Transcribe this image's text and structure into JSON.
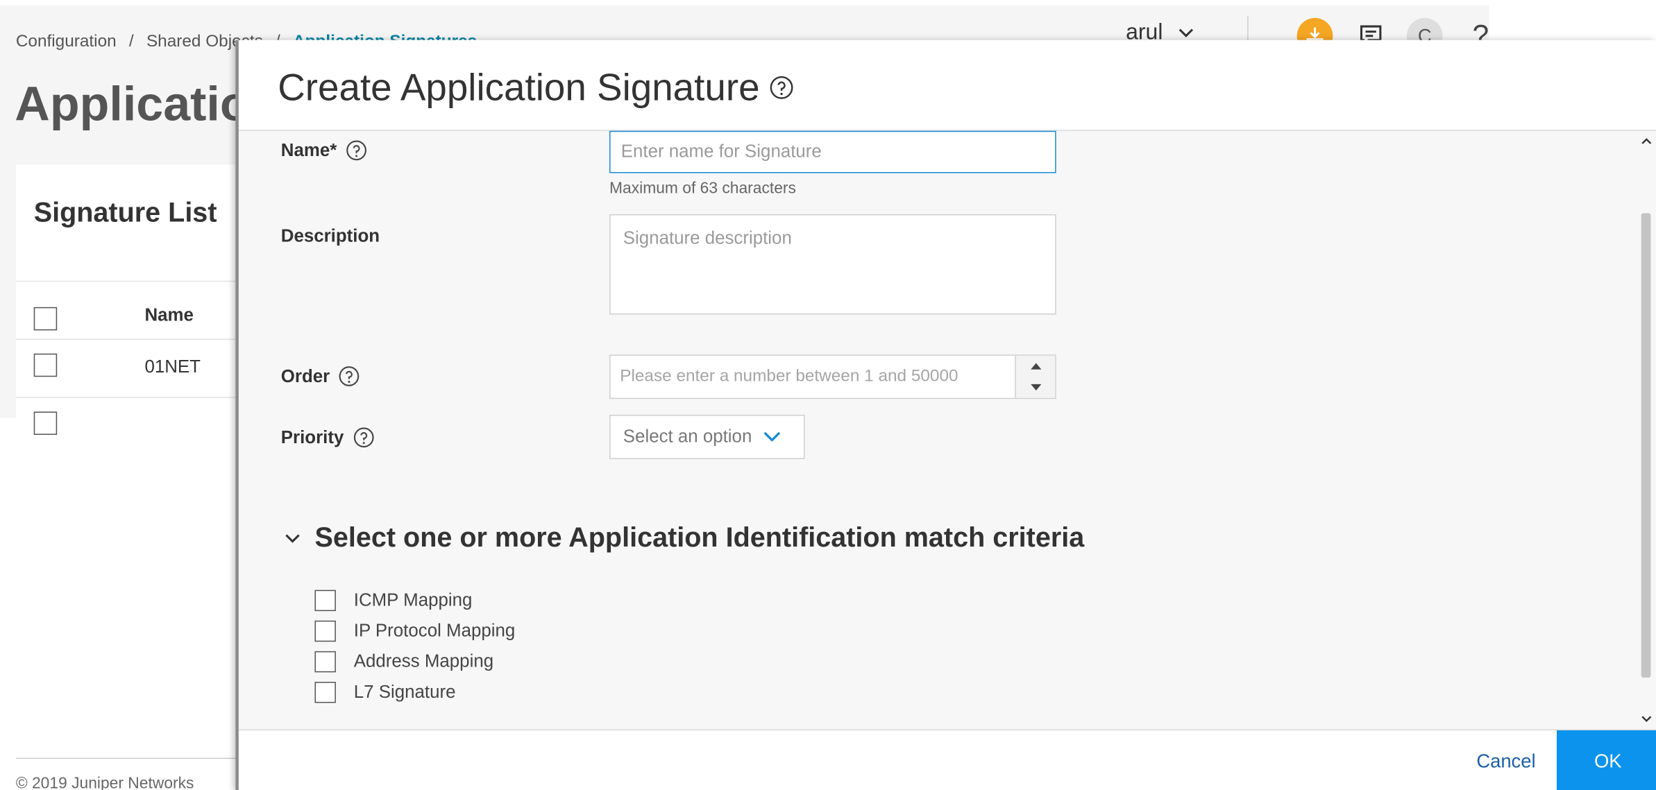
{
  "breadcrumb": {
    "items": [
      "Configuration",
      "Shared Objects"
    ],
    "current": "Application Signatures",
    "separator": "/"
  },
  "page": {
    "title": "Application Signatures",
    "footer": "© 2019 Juniper Networks"
  },
  "header": {
    "user": "arul",
    "avatar_letter": "C",
    "help_glyph": "?",
    "icons": [
      "download-icon",
      "chat-icon",
      "avatar",
      "help-icon"
    ]
  },
  "signature_list": {
    "title": "Signature List",
    "columns": [
      "Name"
    ],
    "rows": [
      {
        "name": "01NET"
      }
    ]
  },
  "modal": {
    "title": "Create Application Signature",
    "form": {
      "name_label": "Name*",
      "name_placeholder": "Enter name for Signature",
      "name_hint": "Maximum of 63 characters",
      "description_label": "Description",
      "description_placeholder": "Signature description",
      "order_label": "Order",
      "order_placeholder": "Please enter a number between 1 and 50000",
      "priority_label": "Priority",
      "priority_value": "Select an option"
    },
    "match_section": {
      "title": "Select one or more Application Identification match criteria",
      "expanded": true,
      "options": [
        {
          "label": "ICMP Mapping",
          "checked": false
        },
        {
          "label": "IP Protocol Mapping",
          "checked": false
        },
        {
          "label": "Address Mapping",
          "checked": false
        },
        {
          "label": "L7 Signature",
          "checked": false
        }
      ]
    },
    "footer": {
      "cancel_label": "Cancel",
      "ok_label": "OK"
    }
  },
  "colors": {
    "accent": "#0b93ee",
    "link": "#1a5fa8",
    "breadcrumb_active": "#0b84a5",
    "notification": "#f5a623"
  }
}
